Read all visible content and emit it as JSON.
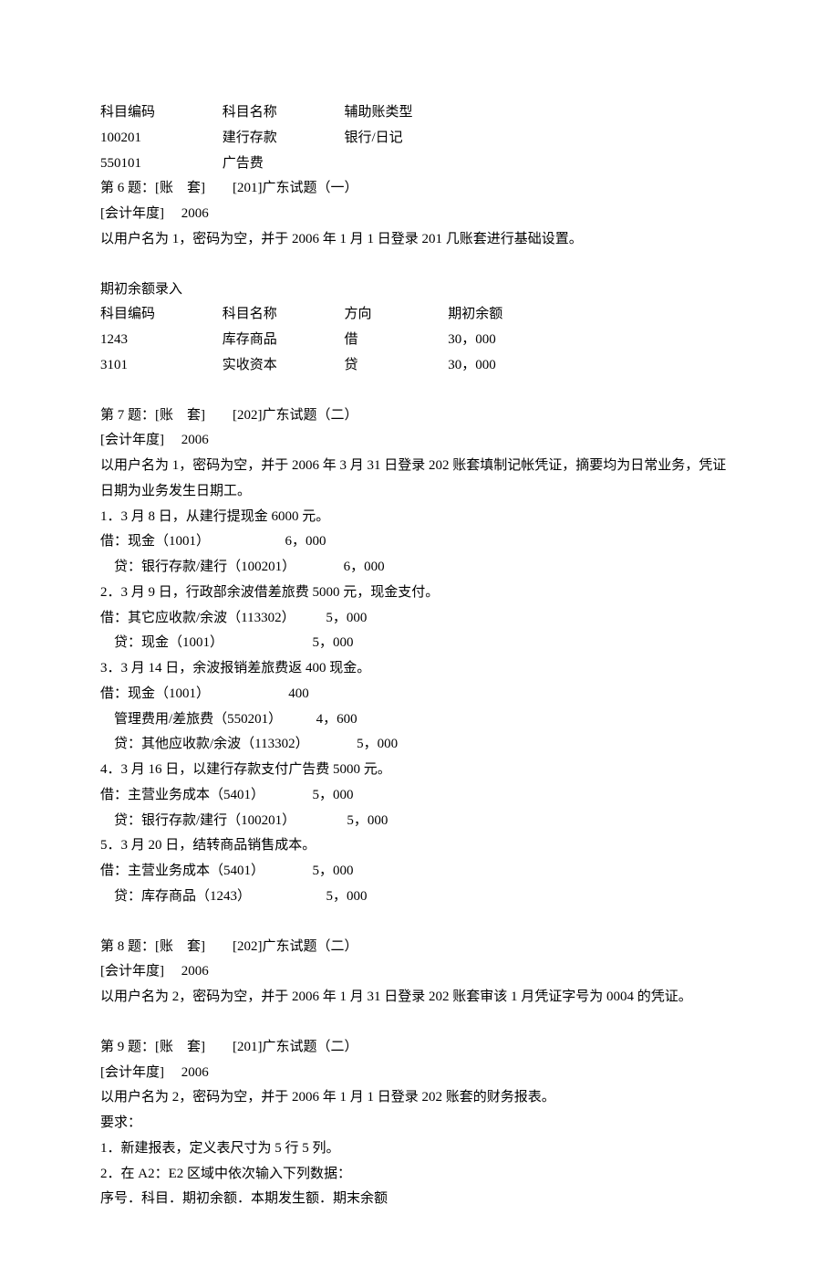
{
  "table1": {
    "headers": [
      "科目编码",
      "科目名称",
      "辅助账类型"
    ],
    "rows": [
      [
        "100201",
        "建行存款",
        "银行/日记"
      ],
      [
        "550101",
        "广告费",
        ""
      ]
    ]
  },
  "q6": {
    "title": "第 6 题：[账　套]　　[201]广东试题（一）",
    "year_label": "[会计年度]　 2006",
    "instruction": "以用户名为 1，密码为空，并于 2006 年 1 月 1 日登录 201 几账套进行基础设置。",
    "sub_heading": "期初余额录入",
    "table": {
      "headers": [
        "科目编码",
        "科目名称",
        "方向",
        "期初余额"
      ],
      "rows": [
        [
          "1243",
          "库存商品",
          "借",
          "30，000"
        ],
        [
          "3101",
          "实收资本",
          "贷",
          "30，000"
        ]
      ]
    }
  },
  "q7": {
    "title": "第 7 题：[账　套]　　[202]广东试题（二）",
    "year_label": "[会计年度]　 2006",
    "instruction": "以用户名为 1，密码为空，并于 2006 年 3 月 31 日登录 202 账套填制记帐凭证，摘要均为日常业务，凭证日期为业务发生日期工。",
    "items": [
      {
        "desc": "1．3 月 8 日，从建行提现金 6000 元。",
        "lines": [
          "借：现金（1001）                      6，000",
          "    贷：银行存款/建行（100201）              6，000"
        ]
      },
      {
        "desc": "2．3 月 9 日，行政部余波借差旅费 5000 元，现金支付。",
        "lines": [
          "借：其它应收款/余波（113302）         5，000",
          "    贷：现金（1001）                          5，000"
        ]
      },
      {
        "desc": "3．3 月 14 日，余波报销差旅费返 400 现金。",
        "lines": [
          "借：现金（1001）                       400",
          "    管理费用/差旅费（550201）          4，600",
          "    贷：其他应收款/余波（113302）              5，000"
        ]
      },
      {
        "desc": "4．3 月 16 日，以建行存款支付广告费 5000 元。",
        "lines": [
          "借：主营业务成本（5401）              5，000",
          "    贷：银行存款/建行（100201）               5，000"
        ]
      },
      {
        "desc": "5．3 月 20 日，结转商品销售成本。",
        "lines": [
          "借：主营业务成本（5401）              5，000",
          "    贷：库存商品（1243）                      5，000"
        ]
      }
    ]
  },
  "q8": {
    "title": "第 8 题：[账　套]　　[202]广东试题（二）",
    "year_label": "[会计年度]　 2006",
    "instruction": "以用户名为 2，密码为空，并于 2006 年 1 月 31 日登录 202 账套审该 1 月凭证字号为 0004 的凭证。"
  },
  "q9": {
    "title": "第 9 题：[账　套]　　[201]广东试题（二）",
    "year_label": "[会计年度]　 2006",
    "instruction": "以用户名为 2，密码为空，并于 2006 年 1 月 1 日登录 202 账套的财务报表。",
    "req_label": "要求：",
    "reqs": [
      "1．新建报表，定义表尺寸为 5 行 5 列。",
      "2．在 A2：E2 区域中依次输入下列数据：",
      "序号．科目．期初余额．本期发生额．期末余额"
    ]
  }
}
